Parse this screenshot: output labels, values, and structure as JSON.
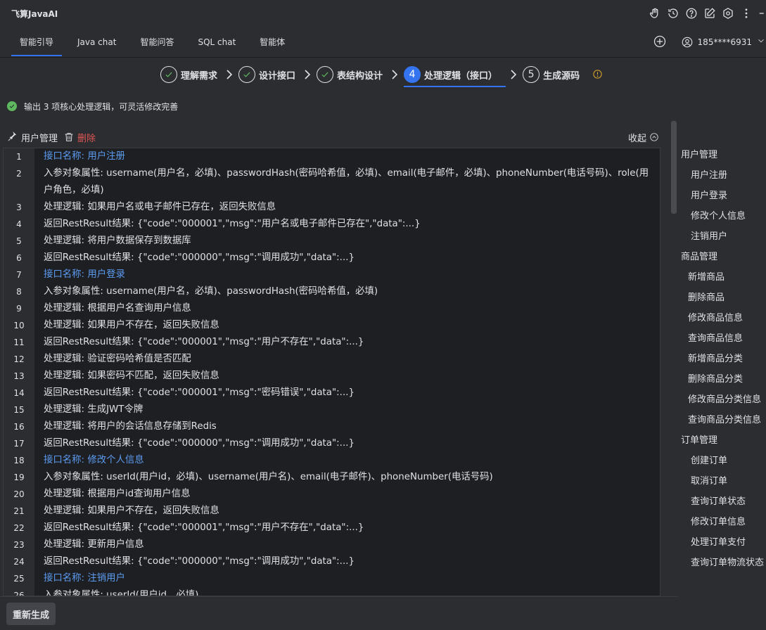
{
  "app": {
    "title": "飞算JavaAI"
  },
  "tabs": [
    {
      "label": "智能引导",
      "active": true
    },
    {
      "label": "Java chat",
      "active": false
    },
    {
      "label": "智能问答",
      "active": false
    },
    {
      "label": "SQL chat",
      "active": false
    },
    {
      "label": "智能体",
      "active": false
    }
  ],
  "user": {
    "phone": "185****6931"
  },
  "steps": [
    {
      "num": "1",
      "label": "理解需求",
      "status": "done"
    },
    {
      "num": "2",
      "label": "设计接口",
      "status": "done"
    },
    {
      "num": "3",
      "label": "表结构设计",
      "status": "done"
    },
    {
      "num": "4",
      "label": "处理逻辑（接口）",
      "status": "active"
    },
    {
      "num": "5",
      "label": "生成源码",
      "status": "pending"
    }
  ],
  "status_message": "输出 3 项核心处理逻辑，可灵活修改完善",
  "section": {
    "title": "用户管理",
    "delete_label": "删除",
    "collapse_label": "收起"
  },
  "code_lines": [
    {
      "n": "1",
      "text": "接口名称: 用户注册",
      "header": true
    },
    {
      "n": "2",
      "text": "入参对象属性: username(用户名，必填)、passwordHash(密码哈希值，必填)、email(电子邮件，必填)、phoneNumber(电话号码)、role(用户角色，必填)",
      "header": false
    },
    {
      "n": "3",
      "text": "处理逻辑: 如果用户名或电子邮件已存在，返回失败信息",
      "header": false
    },
    {
      "n": "4",
      "text": "返回RestResult结果: {\"code\":\"000001\",\"msg\":\"用户名或电子邮件已存在\",\"data\":...}",
      "header": false
    },
    {
      "n": "5",
      "text": "处理逻辑: 将用户数据保存到数据库",
      "header": false
    },
    {
      "n": "6",
      "text": "返回RestResult结果: {\"code\":\"000000\",\"msg\":\"调用成功\",\"data\":...}",
      "header": false
    },
    {
      "n": "7",
      "text": "接口名称: 用户登录",
      "header": true
    },
    {
      "n": "8",
      "text": "入参对象属性: username(用户名，必填)、passwordHash(密码哈希值，必填)",
      "header": false
    },
    {
      "n": "9",
      "text": "处理逻辑: 根据用户名查询用户信息",
      "header": false
    },
    {
      "n": "10",
      "text": "处理逻辑: 如果用户不存在，返回失败信息",
      "header": false
    },
    {
      "n": "11",
      "text": "返回RestResult结果: {\"code\":\"000001\",\"msg\":\"用户不存在\",\"data\":...}",
      "header": false
    },
    {
      "n": "12",
      "text": "处理逻辑: 验证密码哈希值是否匹配",
      "header": false
    },
    {
      "n": "13",
      "text": "处理逻辑: 如果密码不匹配，返回失败信息",
      "header": false
    },
    {
      "n": "14",
      "text": "返回RestResult结果: {\"code\":\"000001\",\"msg\":\"密码错误\",\"data\":...}",
      "header": false
    },
    {
      "n": "15",
      "text": "处理逻辑: 生成JWT令牌",
      "header": false
    },
    {
      "n": "16",
      "text": "处理逻辑: 将用户的会话信息存储到Redis",
      "header": false
    },
    {
      "n": "17",
      "text": "返回RestResult结果: {\"code\":\"000000\",\"msg\":\"调用成功\",\"data\":...}",
      "header": false
    },
    {
      "n": "18",
      "text": "接口名称: 修改个人信息",
      "header": true
    },
    {
      "n": "19",
      "text": "入参对象属性: userId(用户id，必填)、username(用户名)、email(电子邮件)、phoneNumber(电话号码)",
      "header": false
    },
    {
      "n": "20",
      "text": "处理逻辑: 根据用户id查询用户信息",
      "header": false
    },
    {
      "n": "21",
      "text": "处理逻辑: 如果用户不存在，返回失败信息",
      "header": false
    },
    {
      "n": "22",
      "text": "返回RestResult结果: {\"code\":\"000001\",\"msg\":\"用户不存在\",\"data\":...}",
      "header": false
    },
    {
      "n": "23",
      "text": "处理逻辑: 更新用户信息",
      "header": false
    },
    {
      "n": "24",
      "text": "返回RestResult结果: {\"code\":\"000000\",\"msg\":\"调用成功\",\"data\":...}",
      "header": false
    },
    {
      "n": "25",
      "text": "接口名称: 注销用户",
      "header": true
    },
    {
      "n": "26",
      "text": "入参对象属性: userId(用户id，必填)",
      "header": false
    }
  ],
  "nav": [
    {
      "label": "用户管理",
      "level": "group"
    },
    {
      "label": "用户注册",
      "level": "child"
    },
    {
      "label": "用户登录",
      "level": "child"
    },
    {
      "label": "修改个人信息",
      "level": "child"
    },
    {
      "label": "注销用户",
      "level": "child"
    },
    {
      "label": "商品管理",
      "level": "group"
    },
    {
      "label": "新增商品",
      "level": "child2"
    },
    {
      "label": "删除商品",
      "level": "child2"
    },
    {
      "label": "修改商品信息",
      "level": "child2"
    },
    {
      "label": "查询商品信息",
      "level": "child2"
    },
    {
      "label": "新增商品分类",
      "level": "child2"
    },
    {
      "label": "删除商品分类",
      "level": "child2"
    },
    {
      "label": "修改商品分类信息",
      "level": "child2"
    },
    {
      "label": "查询商品分类信息",
      "level": "child2"
    },
    {
      "label": "订单管理",
      "level": "group"
    },
    {
      "label": "创建订单",
      "level": "child"
    },
    {
      "label": "取消订单",
      "level": "child"
    },
    {
      "label": "查询订单状态",
      "level": "child"
    },
    {
      "label": "修改订单信息",
      "level": "child"
    },
    {
      "label": "处理订单支付",
      "level": "child"
    },
    {
      "label": "查询订单物流状态",
      "level": "child"
    }
  ],
  "regenerate_label": "重新生成",
  "colors": {
    "accent": "#3574f0",
    "success": "#5fb85f",
    "danger": "#e05555",
    "warning": "#e0a82e",
    "link": "#5b9bf0"
  }
}
